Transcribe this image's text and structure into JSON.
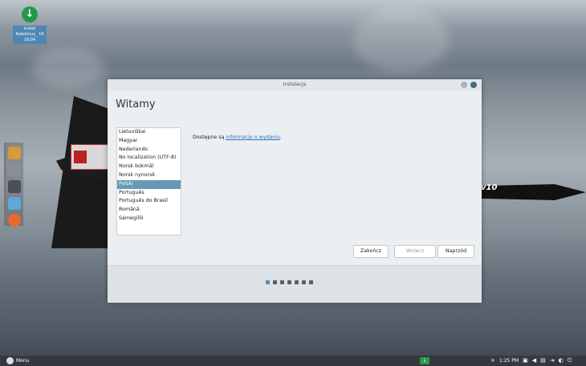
{
  "desktop": {
    "icon_label": "Install Robolinux_ 10 18.04",
    "plane_text": "v10"
  },
  "window": {
    "title": "Instalacja",
    "heading": "Witamy",
    "languages": [
      "Lietuviškai",
      "Magyar",
      "Nederlands",
      "No localization (UTF-8)",
      "Norsk bokmål",
      "Norsk nynorsk",
      "Polski",
      "Português",
      "Português do Brasil",
      "Română",
      "Sámegillii"
    ],
    "selected_language": "Polski",
    "release_text_prefix": "Dostępne są ",
    "release_link": "informacje o wydaniu",
    "release_text_suffix": ".",
    "buttons": {
      "quit": "Zakończ",
      "back": "Wstecz",
      "forward": "Naprzód"
    },
    "pager": {
      "total": 7,
      "current": 1
    }
  },
  "taskbar": {
    "menu_label": "Menu",
    "time": "1:25 PM"
  },
  "colors": {
    "selection": "#6699b3",
    "link": "#2a6ebd",
    "install_icon": "#1f9a4a"
  }
}
